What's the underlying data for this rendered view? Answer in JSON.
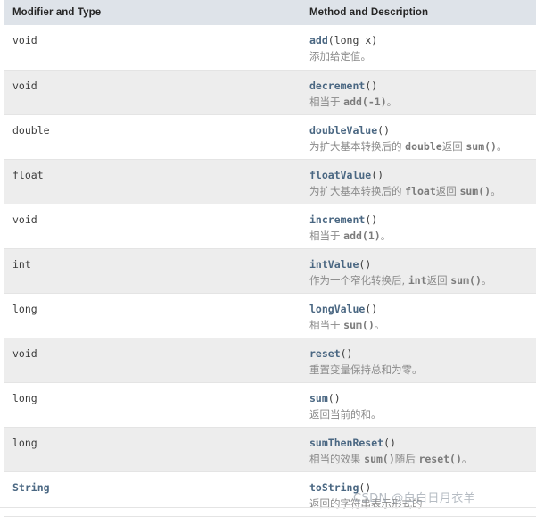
{
  "table": {
    "headers": {
      "type_column": "Modifier and Type",
      "method_column": "Method and Description"
    },
    "colors": {
      "header_bg": "#dee3e9",
      "row_alt_bg": "#ededed",
      "row_bg": "#ffffff",
      "link_blue": "#4a6782",
      "desc_gray": "#8a8a8a",
      "border": "#e4e4e4"
    },
    "rows": [
      {
        "type": "void",
        "type_is_reference": false,
        "method_name": "add",
        "method_args": "(long x)",
        "desc_parts": [
          {
            "text": "添加给定值。",
            "code": false
          }
        ]
      },
      {
        "type": "void",
        "type_is_reference": false,
        "method_name": "decrement",
        "method_args": "()",
        "desc_parts": [
          {
            "text": "相当于 ",
            "code": false
          },
          {
            "text": "add(-1)",
            "code": true
          },
          {
            "text": "。",
            "code": false
          }
        ]
      },
      {
        "type": "double",
        "type_is_reference": false,
        "method_name": "doubleValue",
        "method_args": "()",
        "desc_parts": [
          {
            "text": "为扩大基本转换后的 ",
            "code": false
          },
          {
            "text": "double",
            "code": true
          },
          {
            "text": "返回 ",
            "code": false
          },
          {
            "text": "sum()",
            "code": true
          },
          {
            "text": "。",
            "code": false
          }
        ]
      },
      {
        "type": "float",
        "type_is_reference": false,
        "method_name": "floatValue",
        "method_args": "()",
        "desc_parts": [
          {
            "text": "为扩大基本转换后的 ",
            "code": false
          },
          {
            "text": "float",
            "code": true
          },
          {
            "text": "返回 ",
            "code": false
          },
          {
            "text": "sum()",
            "code": true
          },
          {
            "text": "。",
            "code": false
          }
        ]
      },
      {
        "type": "void",
        "type_is_reference": false,
        "method_name": "increment",
        "method_args": "()",
        "desc_parts": [
          {
            "text": "相当于 ",
            "code": false
          },
          {
            "text": "add(1)",
            "code": true
          },
          {
            "text": "。",
            "code": false
          }
        ]
      },
      {
        "type": "int",
        "type_is_reference": false,
        "method_name": "intValue",
        "method_args": "()",
        "desc_parts": [
          {
            "text": "作为一个窄化转换后, ",
            "code": false
          },
          {
            "text": "int",
            "code": true
          },
          {
            "text": "返回 ",
            "code": false
          },
          {
            "text": "sum()",
            "code": true
          },
          {
            "text": "。",
            "code": false
          }
        ]
      },
      {
        "type": "long",
        "type_is_reference": false,
        "method_name": "longValue",
        "method_args": "()",
        "desc_parts": [
          {
            "text": "相当于 ",
            "code": false
          },
          {
            "text": "sum()",
            "code": true
          },
          {
            "text": "。",
            "code": false
          }
        ]
      },
      {
        "type": "void",
        "type_is_reference": false,
        "method_name": "reset",
        "method_args": "()",
        "desc_parts": [
          {
            "text": "重置变量保持总和为零。",
            "code": false
          }
        ]
      },
      {
        "type": "long",
        "type_is_reference": false,
        "method_name": "sum",
        "method_args": "()",
        "desc_parts": [
          {
            "text": "返回当前的和。",
            "code": false
          }
        ]
      },
      {
        "type": "long",
        "type_is_reference": false,
        "method_name": "sumThenReset",
        "method_args": "()",
        "desc_parts": [
          {
            "text": "相当的效果 ",
            "code": false
          },
          {
            "text": "sum()",
            "code": true
          },
          {
            "text": "随后 ",
            "code": false
          },
          {
            "text": "reset()",
            "code": true
          },
          {
            "text": "。",
            "code": false
          }
        ]
      },
      {
        "type": "String",
        "type_is_reference": true,
        "method_name": "toString",
        "method_args": "()",
        "desc_parts": [
          {
            "text": "返回的字符串表示形式的",
            "code": false
          }
        ]
      }
    ]
  },
  "watermark": {
    "text": "CSDN @白白日月衣羊"
  }
}
